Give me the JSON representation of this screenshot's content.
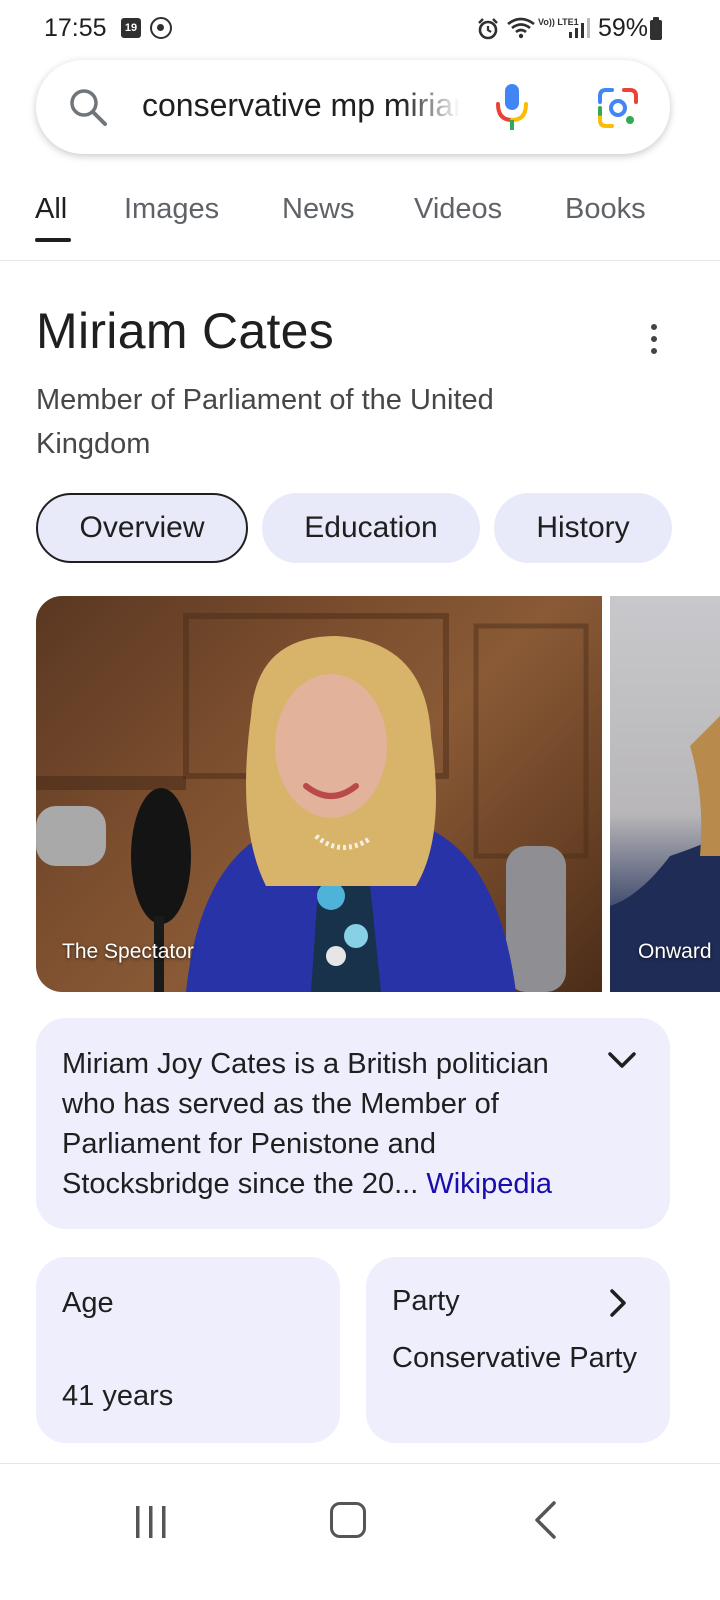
{
  "status_bar": {
    "time": "17:55",
    "calendar_day": "19",
    "network": "Vo)) LTE1",
    "battery": "59%"
  },
  "search": {
    "query": "conservative mp miriam cates"
  },
  "tabs": [
    {
      "label": "All",
      "active": true
    },
    {
      "label": "Images",
      "active": false
    },
    {
      "label": "News",
      "active": false
    },
    {
      "label": "Videos",
      "active": false
    },
    {
      "label": "Books",
      "active": false
    }
  ],
  "knowledge_panel": {
    "title": "Miriam Cates",
    "subtitle": "Member of Parliament of the United Kingdom",
    "chips": [
      {
        "label": "Overview",
        "active": true
      },
      {
        "label": "Education",
        "active": false
      },
      {
        "label": "History",
        "active": false
      }
    ],
    "images": [
      {
        "caption": "The Spectator"
      },
      {
        "caption": "Onward"
      }
    ],
    "description": {
      "text": "Miriam Joy Cates is a British politician who has served as the Member of Parliament for Penistone and Stocksbridge since the 20...",
      "source": "Wikipedia"
    },
    "facts": [
      {
        "label": "Age",
        "value": "41 years"
      },
      {
        "label": "Party",
        "value": "Conservative Party"
      }
    ]
  },
  "colors": {
    "chip_bg": "#e8e9f9",
    "card_bg": "#eeeefc",
    "link": "#1a0dab",
    "text": "#1f1f1f"
  },
  "icons": [
    "search-icon",
    "mic-icon",
    "lens-icon",
    "more-vert-icon",
    "chevron-down-icon",
    "chevron-right-icon",
    "nav-recent-icon",
    "nav-home-icon",
    "nav-back-icon"
  ]
}
